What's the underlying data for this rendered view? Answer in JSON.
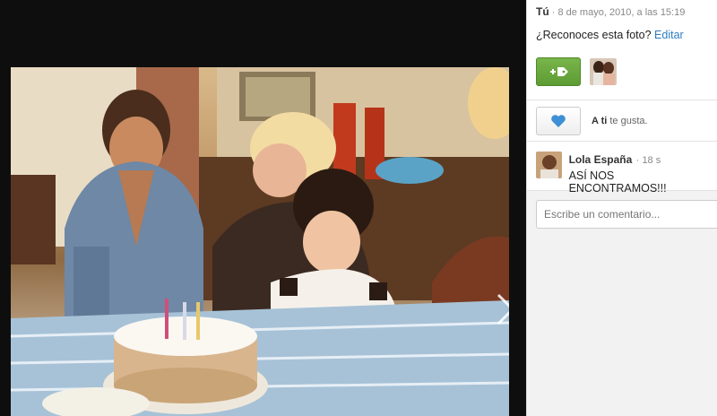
{
  "post": {
    "author": "Tú",
    "timestamp": "8 de mayo, 2010, a las 15:19",
    "caption": "¿Reconoces esta foto?",
    "edit_label": "Editar"
  },
  "likes": {
    "who": "A ti",
    "text": "te gusta."
  },
  "comment": {
    "author": "Lola España",
    "time": "18 s",
    "text": "ASÍ NOS ENCONTRAMOS!!!"
  },
  "reply": {
    "placeholder": "Escribe un comentario..."
  },
  "colors": {
    "accent_green": "#5d9b34",
    "link_blue": "#2c7cc1",
    "like_heart": "#3d8fd6"
  },
  "icons": [
    "tag-add-icon",
    "heart-icon",
    "chevron-right-icon"
  ]
}
